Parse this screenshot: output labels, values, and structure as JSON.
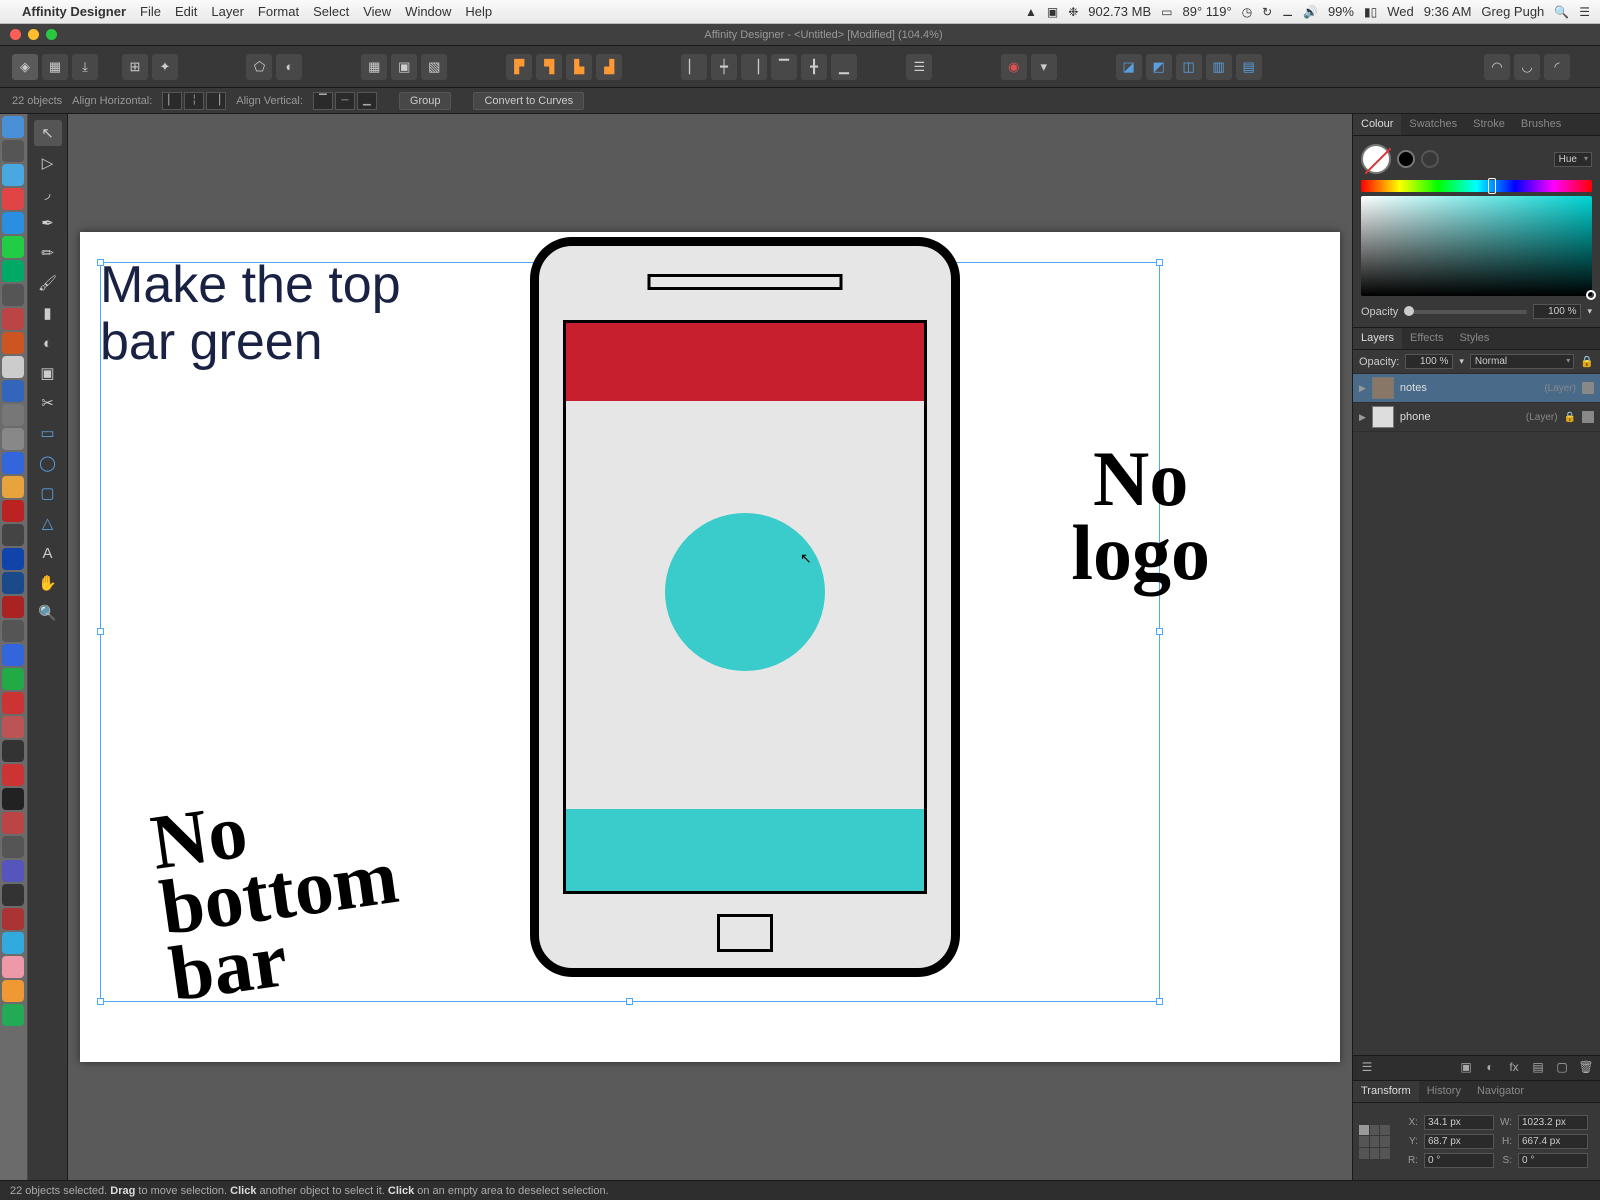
{
  "menubar": {
    "app_name": "Affinity Designer",
    "items": [
      "File",
      "Edit",
      "Layer",
      "Format",
      "Select",
      "View",
      "Window",
      "Help"
    ],
    "memory": "902.73 MB",
    "temps": "89° 119°",
    "battery": "99%",
    "day": "Wed",
    "time": "9:36 AM",
    "user": "Greg Pugh"
  },
  "titlebar": {
    "title": "Affinity Designer - <Untitled> [Modified] (104.4%)"
  },
  "contextbar": {
    "selection_count": "22 objects",
    "align_h_label": "Align Horizontal:",
    "align_v_label": "Align Vertical:",
    "group_btn": "Group",
    "curves_btn": "Convert to Curves"
  },
  "canvas": {
    "note_text": "Make the top\nbar green",
    "hand_note_1": "No\nbottom\nbar",
    "hand_note_2": "No\nlogo"
  },
  "colour": {
    "tabs": [
      "Colour",
      "Swatches",
      "Stroke",
      "Brushes"
    ],
    "mode": "Hue",
    "opacity_label": "Opacity",
    "opacity_value": "100 %"
  },
  "layers": {
    "tabs": [
      "Layers",
      "Effects",
      "Styles"
    ],
    "opacity_label": "Opacity:",
    "opacity_value": "100 %",
    "blend_mode": "Normal",
    "items": [
      {
        "name": "notes",
        "type": "(Layer)",
        "selected": true
      },
      {
        "name": "phone",
        "type": "(Layer)",
        "selected": false
      }
    ]
  },
  "transform": {
    "tabs": [
      "Transform",
      "History",
      "Navigator"
    ],
    "x": "34.1 px",
    "y": "68.7 px",
    "w": "1023.2 px",
    "h": "667.4 px",
    "r": "0 °",
    "s": "0 °"
  },
  "status": {
    "text_prefix": "22 objects selected. ",
    "b1": "Drag",
    "t1": " to move selection. ",
    "b2": "Click",
    "t2": " another object to select it. ",
    "b3": "Click",
    "t3": " on an empty area to deselect selection."
  }
}
